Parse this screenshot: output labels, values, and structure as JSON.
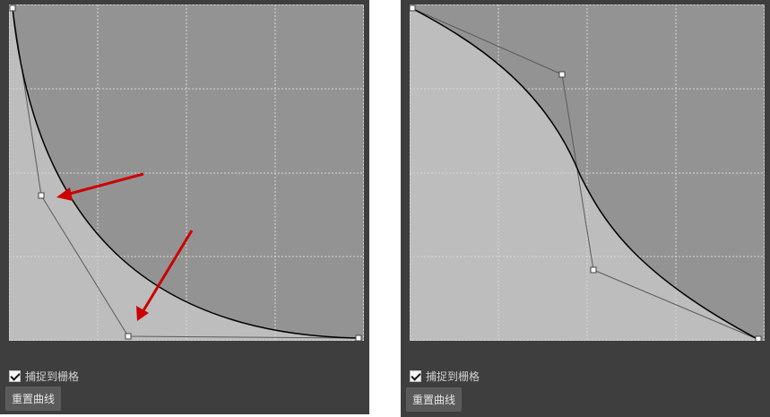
{
  "left_panel": {
    "snap_label": "捕捉到栅格",
    "snap_checked": true,
    "reset_label": "重置曲线"
  },
  "right_panel": {
    "snap_label": "捕捉到栅格",
    "snap_checked": true,
    "reset_label": "重置曲线"
  },
  "colors": {
    "panel_bg": "#3e3e3e",
    "plot_dark": "#939393",
    "plot_light": "#bdbdbd",
    "grid": "#d8d8d8",
    "curve": "#000000",
    "control_lines": "#5a5a5a",
    "arrows": "#cc0000"
  }
}
